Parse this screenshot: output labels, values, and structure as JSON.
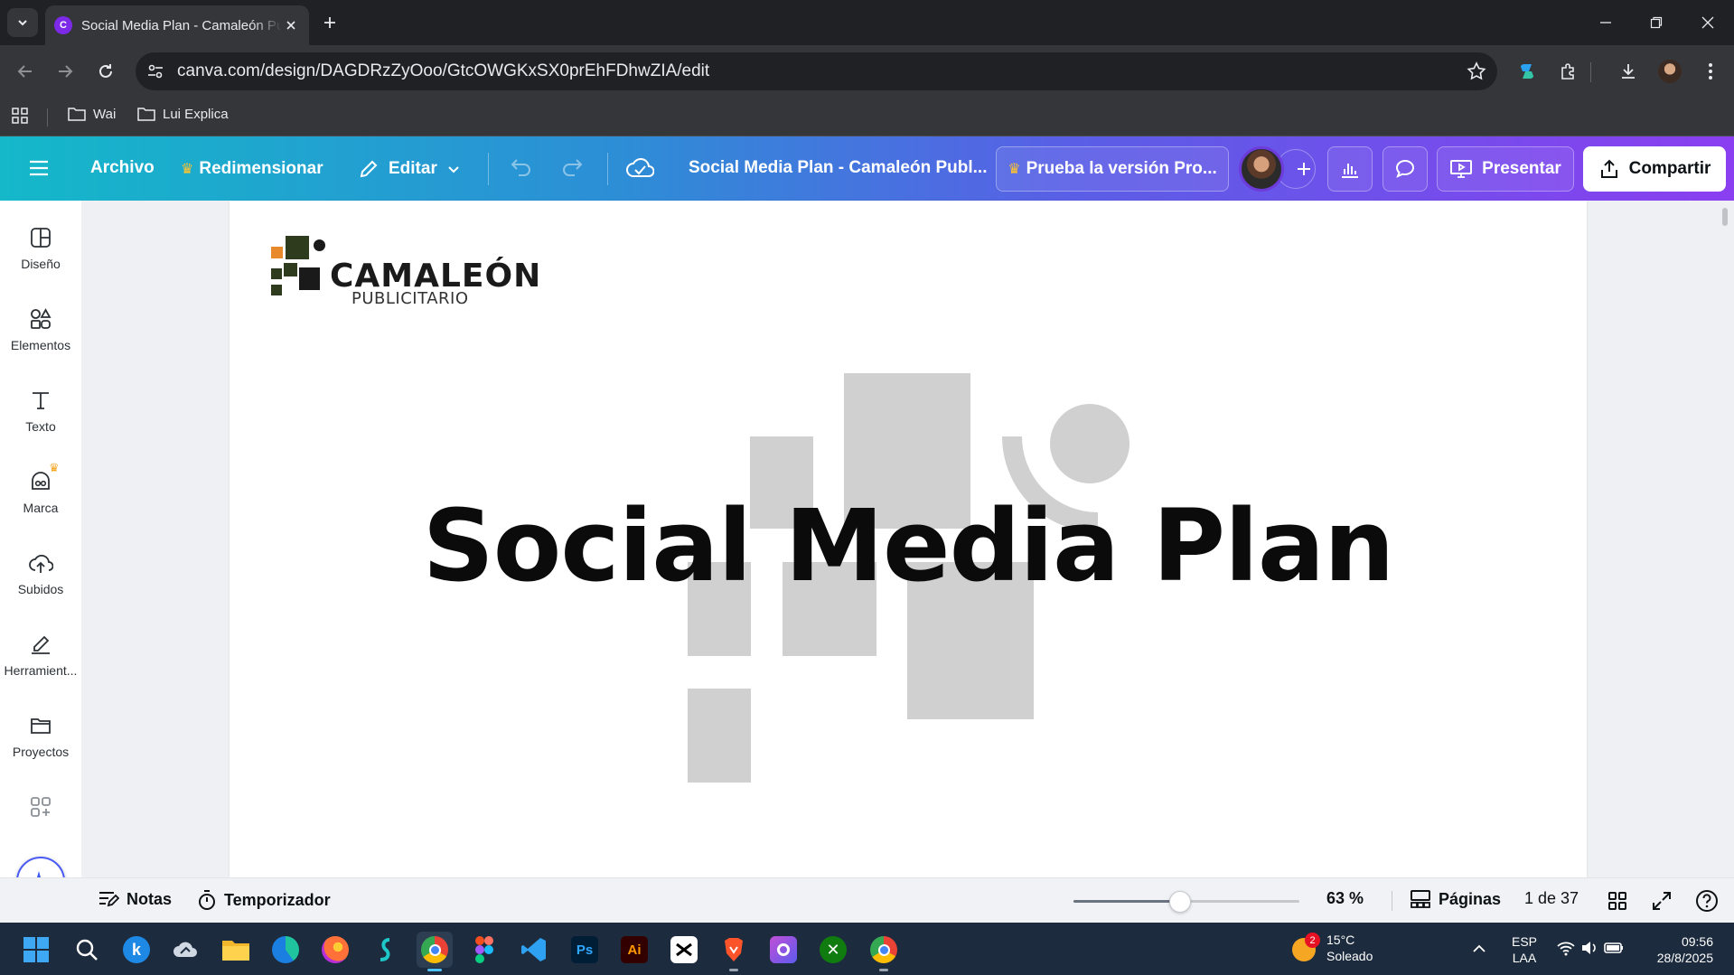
{
  "browser": {
    "tab_title": "Social Media Plan - Camaleón Publicitario",
    "url": "canva.com/design/DAGDRzZyOoo/GtcOWGKxSX0prEhFDhwZIA/edit",
    "bookmarks": [
      {
        "label": "Wai"
      },
      {
        "label": "Lui Explica"
      }
    ]
  },
  "canva_header": {
    "archivo": "Archivo",
    "redimensionar": "Redimensionar",
    "editar": "Editar",
    "doc_title": "Social Media Plan - Camaleón Publ...",
    "pro_trial": "Prueba la versión Pro...",
    "presentar": "Presentar",
    "compartir": "Compartir"
  },
  "sidebar": {
    "items": [
      {
        "label": "Diseño",
        "icon": "layout-icon"
      },
      {
        "label": "Elementos",
        "icon": "shapes-icon"
      },
      {
        "label": "Texto",
        "icon": "text-icon"
      },
      {
        "label": "Marca",
        "icon": "brand-icon"
      },
      {
        "label": "Subidos",
        "icon": "upload-icon"
      },
      {
        "label": "Herramient...",
        "icon": "tools-icon"
      },
      {
        "label": "Proyectos",
        "icon": "folder-icon"
      }
    ]
  },
  "slide": {
    "logo_line1": "CAMALEÓN",
    "logo_line2": "PUBLICITARIO",
    "headline": "Social Media Plan"
  },
  "footer": {
    "notas": "Notas",
    "temporizador": "Temporizador",
    "zoom": "63 %",
    "zoom_level": 0.47,
    "paginas": "Páginas",
    "page_counter": "1 de 37"
  },
  "taskbar": {
    "weather_temp": "15°C",
    "weather_desc": "Soleado",
    "weather_badge": "2",
    "lang_line1": "ESP",
    "lang_line2": "LAA",
    "time": "09:56",
    "date": "28/8/2025"
  },
  "colors": {
    "canva_gradient_start": "#14b8c9",
    "canva_gradient_end": "#8a3ff0",
    "logo_orange": "#e8892b",
    "logo_green": "#2e3b1c",
    "shape_gray": "#d0d0d1"
  }
}
